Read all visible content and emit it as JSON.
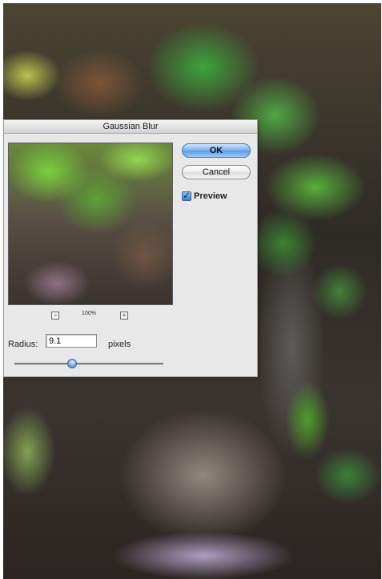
{
  "dialog": {
    "title": "Gaussian Blur",
    "ok_label": "OK",
    "cancel_label": "Cancel",
    "preview_label": "Preview",
    "preview_checked": true,
    "zoom_out_label": "−",
    "zoom_in_label": "+",
    "zoom_level": "100%",
    "radius_label": "Radius:",
    "radius_value": "9.1",
    "radius_units": "pixels",
    "slider_fraction": 0.38
  },
  "colors": {
    "dialog_bg": "#e8e8e8",
    "ok_accent": "#5d9ee6"
  }
}
